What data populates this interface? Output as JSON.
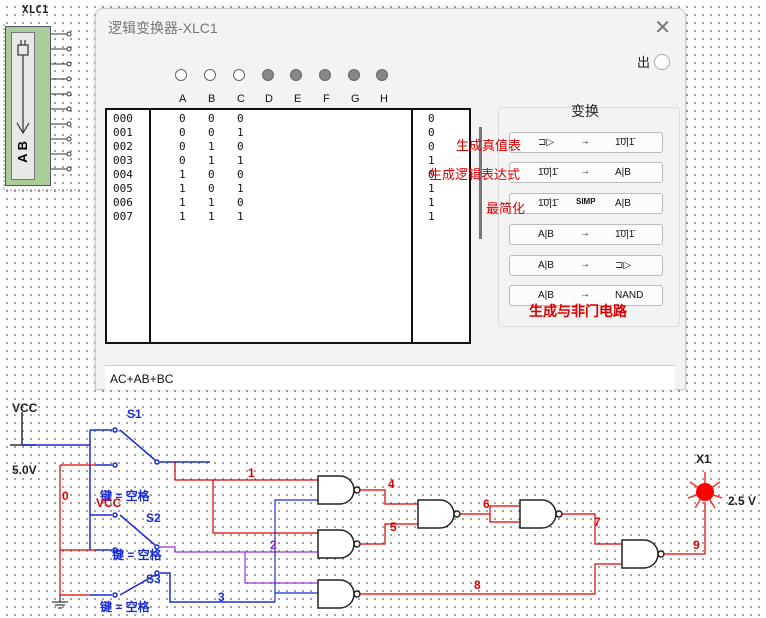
{
  "instrument": {
    "label": "XLC1",
    "icon_text": "A B",
    "pin_count": 10
  },
  "dialog": {
    "title": "逻辑变换器-XLC1",
    "close": "✕",
    "output_label": "出",
    "columns": [
      "A",
      "B",
      "C",
      "D",
      "E",
      "F",
      "G",
      "H"
    ],
    "column_states": [
      "off",
      "off",
      "off",
      "on",
      "on",
      "on",
      "on",
      "on"
    ],
    "truth_table": {
      "rows": [
        {
          "index": "000",
          "a": "0",
          "b": "0",
          "c": "0",
          "out": "0"
        },
        {
          "index": "001",
          "a": "0",
          "b": "0",
          "c": "1",
          "out": "0"
        },
        {
          "index": "002",
          "a": "0",
          "b": "1",
          "c": "0",
          "out": "0"
        },
        {
          "index": "003",
          "a": "0",
          "b": "1",
          "c": "1",
          "out": "1"
        },
        {
          "index": "004",
          "a": "1",
          "b": "0",
          "c": "0",
          "out": "0"
        },
        {
          "index": "005",
          "a": "1",
          "b": "0",
          "c": "1",
          "out": "1"
        },
        {
          "index": "006",
          "a": "1",
          "b": "1",
          "c": "0",
          "out": "1"
        },
        {
          "index": "007",
          "a": "1",
          "b": "1",
          "c": "1",
          "out": "1"
        }
      ]
    },
    "convert": {
      "title": "变换",
      "buttons": [
        {
          "from": "⊐▷",
          "arrow": "→",
          "to": "1̄0̄|1̄"
        },
        {
          "from": "1̄0̄|1̄",
          "arrow": "→",
          "to": "A|B"
        },
        {
          "from": "1̄0̄|1̄",
          "arrow": "SIMP",
          "to": "A|B"
        },
        {
          "from": "A|B",
          "arrow": "→",
          "to": "1̄0̄|1̄"
        },
        {
          "from": "A|B",
          "arrow": "→",
          "to": "⊐▷"
        },
        {
          "from": "A|B",
          "arrow": "→",
          "to": "NAND"
        }
      ]
    },
    "annotations": {
      "truth_table": "生成真值表",
      "expression": "生成逻辑表达式",
      "simplify": "最简化",
      "nand": "生成与非门电路"
    },
    "expression": "AC+AB+BC"
  },
  "circuit": {
    "vcc_top": "VCC",
    "vcc_voltage": "5.0V",
    "vcc_mid": "VCC",
    "ground_node": "0",
    "switches": [
      {
        "name": "S1",
        "key": "键 = 空格"
      },
      {
        "name": "S2",
        "key": "键 = 空格"
      },
      {
        "name": "S3",
        "key": "键 = 空格"
      }
    ],
    "nets": {
      "n1": "1",
      "n2": "2",
      "n3": "3",
      "n4": "4",
      "n5": "5",
      "n6": "6",
      "n7": "7",
      "n8": "8",
      "n9": "9"
    },
    "probe": {
      "name": "X1",
      "voltage": "2.5 V"
    },
    "colors": {
      "red": "#d00000",
      "blue": "#1a2bd6",
      "purple": "#9b30e0",
      "lamp": "#ff0000"
    }
  }
}
